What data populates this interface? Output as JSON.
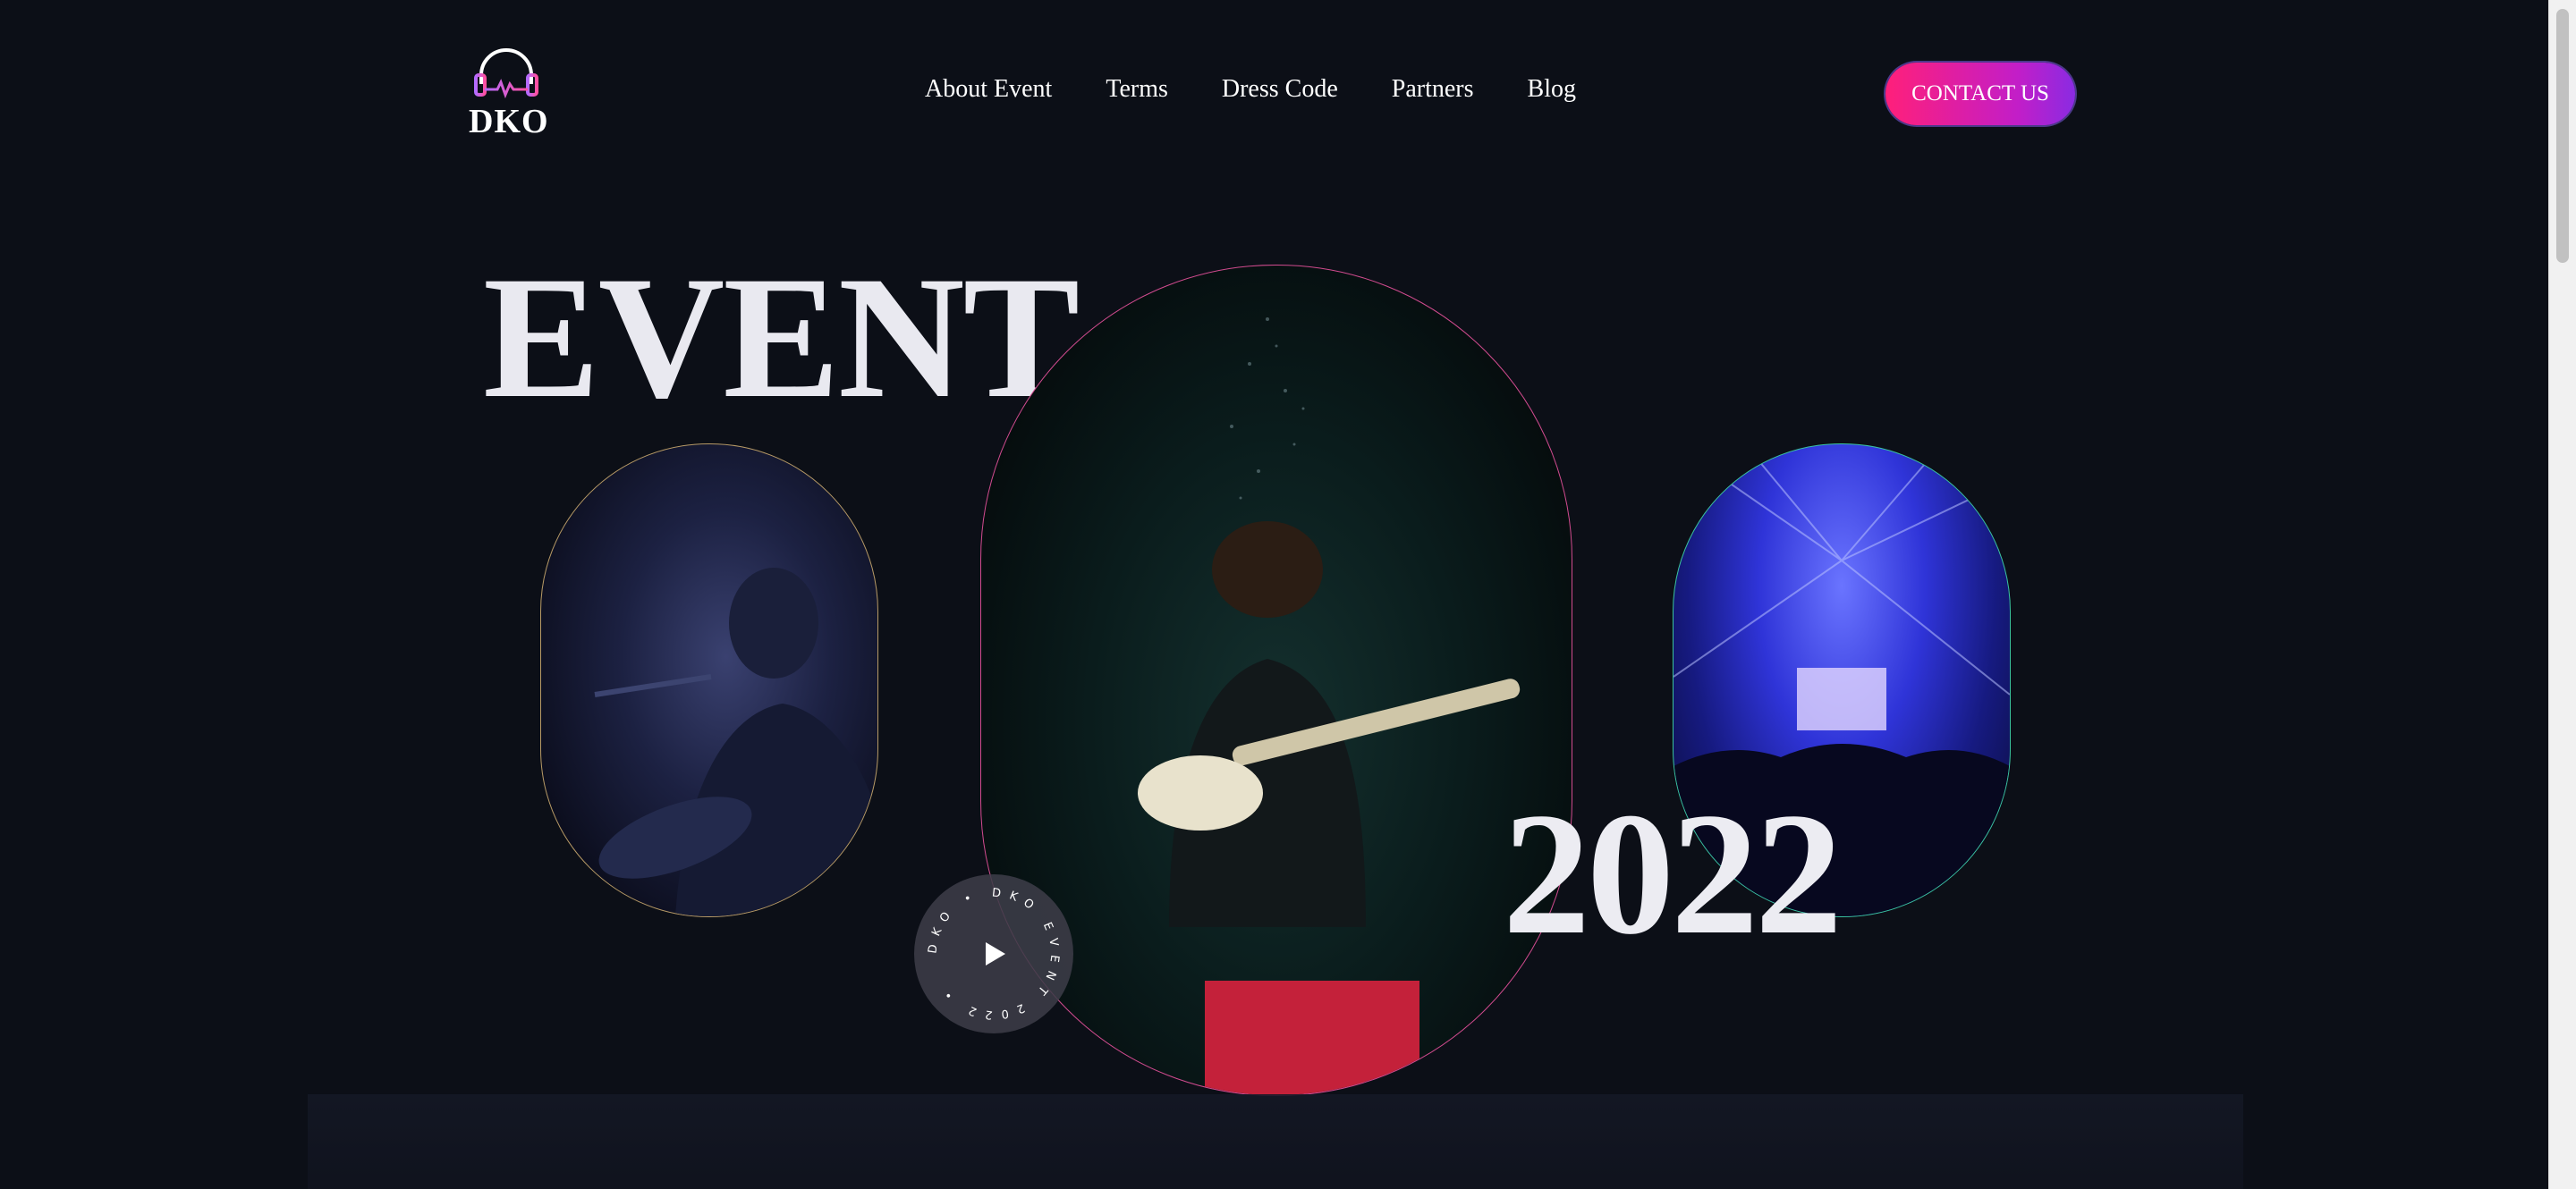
{
  "brand": {
    "name": "DKO",
    "accent_pink": "#ff1f7a",
    "accent_purple": "#8a2be2"
  },
  "nav": {
    "items": [
      {
        "label": "About Event"
      },
      {
        "label": "Terms"
      },
      {
        "label": "Dress Code"
      },
      {
        "label": "Partners"
      },
      {
        "label": "Blog"
      }
    ]
  },
  "header": {
    "contact_label": "CONTACT US"
  },
  "hero": {
    "title": "EVENT",
    "year": "2022",
    "badge_text": "DKO • DKO EVENT 2022 •",
    "images": [
      {
        "name": "singer-with-guitar-photo"
      },
      {
        "name": "bassist-on-stage-photo"
      },
      {
        "name": "laser-light-show-photo"
      }
    ]
  },
  "icons": {
    "logo": "headphones-heartbeat-icon",
    "play": "play-icon"
  }
}
